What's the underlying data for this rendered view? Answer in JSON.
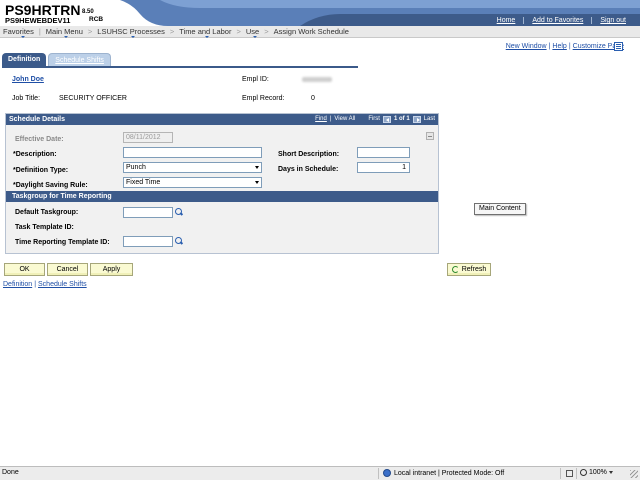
{
  "header": {
    "app_title": "PS9HRTRN",
    "version": "8.50",
    "database": "PS9HEWEBDEV11",
    "user": "RCB",
    "links": [
      "Home",
      "Add to Favorites",
      "Sign out"
    ]
  },
  "breadcrumbs": [
    "Favorites",
    "Main Menu",
    "LSUHSC Processes",
    "Time and Labor",
    "Use",
    "Assign Work Schedule"
  ],
  "tabs": {
    "active": "Definition",
    "inactive": "Schedule Shifts"
  },
  "right_nav": {
    "new_window": "New Window",
    "help": "Help",
    "customize": "Customize Page"
  },
  "employee": {
    "name": "John Doe",
    "job_title_label": "Job Title:",
    "job_title": "SECURITY OFFICER",
    "empl_id_label": "Empl ID:",
    "empl_record_label": "Empl Record:",
    "empl_record": "0"
  },
  "schedule_details": {
    "title": "Schedule Details",
    "nav_find": "Find",
    "nav_view_all": "View All",
    "nav_first": "First",
    "nav_position": "1 of 1",
    "nav_last": "Last",
    "effective_date_label": "Effective Date:",
    "effective_date": "08/11/2012",
    "description_label": "*Description:",
    "description_value": "",
    "definition_type_label": "*Definition Type:",
    "definition_type": "Punch",
    "dst_rule_label": "*Daylight Saving Rule:",
    "dst_rule": "Fixed Time",
    "short_description_label": "Short Description:",
    "short_description_value": "",
    "days_label": "Days in Schedule:",
    "days_value": "1"
  },
  "taskgroup": {
    "title": "Taskgroup for Time Reporting",
    "default_label": "Default Taskgroup:",
    "default_value": "",
    "task_template_label": "Task Template ID:",
    "trt_label": "Time Reporting Template ID:",
    "trt_value": ""
  },
  "buttons": {
    "ok": "OK",
    "cancel": "Cancel",
    "apply": "Apply",
    "refresh": "Refresh"
  },
  "bottom_links": [
    "Definition",
    "Schedule Shifts"
  ],
  "tooltip": "Main Content",
  "statusbar": {
    "status": "Done",
    "zone": "Local intranet | Protected Mode: Off",
    "zoom": "100%"
  },
  "colors": {
    "header_blue": "#3d5b8a",
    "link_blue": "#1f4fa6",
    "button_yellow": "#fafad2"
  }
}
